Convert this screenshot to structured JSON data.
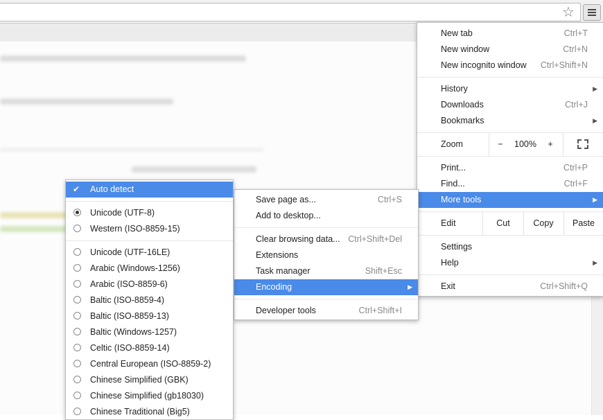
{
  "toolbar": {
    "bookmark_icon": "star-icon",
    "menu_icon": "hamburger-menu-icon"
  },
  "main_menu": {
    "new_tab": {
      "label": "New tab",
      "shortcut": "Ctrl+T"
    },
    "new_window": {
      "label": "New window",
      "shortcut": "Ctrl+N"
    },
    "new_incognito": {
      "label": "New incognito window",
      "shortcut": "Ctrl+Shift+N"
    },
    "history": {
      "label": "History"
    },
    "downloads": {
      "label": "Downloads",
      "shortcut": "Ctrl+J"
    },
    "bookmarks": {
      "label": "Bookmarks"
    },
    "zoom": {
      "label": "Zoom",
      "minus": "−",
      "value": "100%",
      "plus": "+"
    },
    "print": {
      "label": "Print...",
      "shortcut": "Ctrl+P"
    },
    "find": {
      "label": "Find...",
      "shortcut": "Ctrl+F"
    },
    "more_tools": {
      "label": "More tools"
    },
    "edit": {
      "label": "Edit",
      "cut": "Cut",
      "copy": "Copy",
      "paste": "Paste"
    },
    "settings": {
      "label": "Settings"
    },
    "help": {
      "label": "Help"
    },
    "exit": {
      "label": "Exit",
      "shortcut": "Ctrl+Shift+Q"
    }
  },
  "tools_menu": {
    "save_page": {
      "label": "Save page as...",
      "shortcut": "Ctrl+S"
    },
    "add_desktop": {
      "label": "Add to desktop..."
    },
    "clear_browsing": {
      "label": "Clear browsing data...",
      "shortcut": "Ctrl+Shift+Del"
    },
    "extensions": {
      "label": "Extensions"
    },
    "task_manager": {
      "label": "Task manager",
      "shortcut": "Shift+Esc"
    },
    "encoding": {
      "label": "Encoding"
    },
    "developer_tools": {
      "label": "Developer tools",
      "shortcut": "Ctrl+Shift+I"
    }
  },
  "encoding_menu": {
    "auto_detect": "Auto detect",
    "options": [
      "Unicode (UTF-8)",
      "Western (ISO-8859-15)",
      "Unicode (UTF-16LE)",
      "Arabic (Windows-1256)",
      "Arabic (ISO-8859-6)",
      "Baltic (ISO-8859-4)",
      "Baltic (ISO-8859-13)",
      "Baltic (Windows-1257)",
      "Celtic (ISO-8859-14)",
      "Central European (ISO-8859-2)",
      "Chinese Simplified (GBK)",
      "Chinese Simplified (gb18030)",
      "Chinese Traditional (Big5)"
    ],
    "selected": "Unicode (UTF-8)"
  },
  "colors": {
    "highlight": "#4a8ae8",
    "menu_bg": "#ffffff",
    "shortcut_text": "#888888"
  }
}
